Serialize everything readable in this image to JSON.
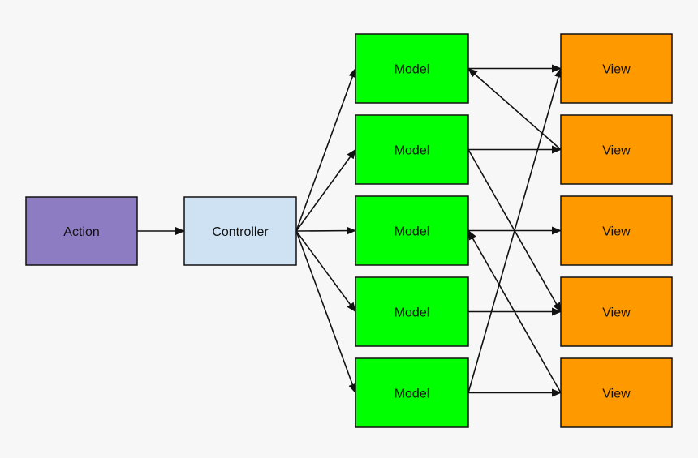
{
  "diagram": {
    "colors": {
      "background": "#f7f7f7",
      "action": "#8e7cc3",
      "controller": "#cfe2f3",
      "model": "#00ff00",
      "view": "#ff9900",
      "stroke": "#111111"
    },
    "nodes": [
      {
        "id": "action",
        "label": "Action",
        "kind": "action"
      },
      {
        "id": "controller",
        "label": "Controller",
        "kind": "controller"
      },
      {
        "id": "model1",
        "label": "Model",
        "kind": "model"
      },
      {
        "id": "model2",
        "label": "Model",
        "kind": "model"
      },
      {
        "id": "model3",
        "label": "Model",
        "kind": "model"
      },
      {
        "id": "model4",
        "label": "Model",
        "kind": "model"
      },
      {
        "id": "model5",
        "label": "Model",
        "kind": "model"
      },
      {
        "id": "view1",
        "label": "View",
        "kind": "view"
      },
      {
        "id": "view2",
        "label": "View",
        "kind": "view"
      },
      {
        "id": "view3",
        "label": "View",
        "kind": "view"
      },
      {
        "id": "view4",
        "label": "View",
        "kind": "view"
      },
      {
        "id": "view5",
        "label": "View",
        "kind": "view"
      }
    ],
    "edges": [
      {
        "from": "action",
        "to": "controller"
      },
      {
        "from": "controller",
        "to": "model1"
      },
      {
        "from": "controller",
        "to": "model2"
      },
      {
        "from": "controller",
        "to": "model3"
      },
      {
        "from": "controller",
        "to": "model4"
      },
      {
        "from": "controller",
        "to": "model5"
      },
      {
        "from": "model1",
        "to": "view1"
      },
      {
        "from": "view2",
        "to": "model1"
      },
      {
        "from": "model2",
        "to": "view2"
      },
      {
        "from": "model2",
        "to": "view4"
      },
      {
        "from": "model3",
        "to": "view3"
      },
      {
        "from": "view5",
        "to": "model3"
      },
      {
        "from": "model4",
        "to": "view4"
      },
      {
        "from": "model5",
        "to": "view5"
      },
      {
        "from": "model5",
        "to": "view1"
      }
    ]
  }
}
